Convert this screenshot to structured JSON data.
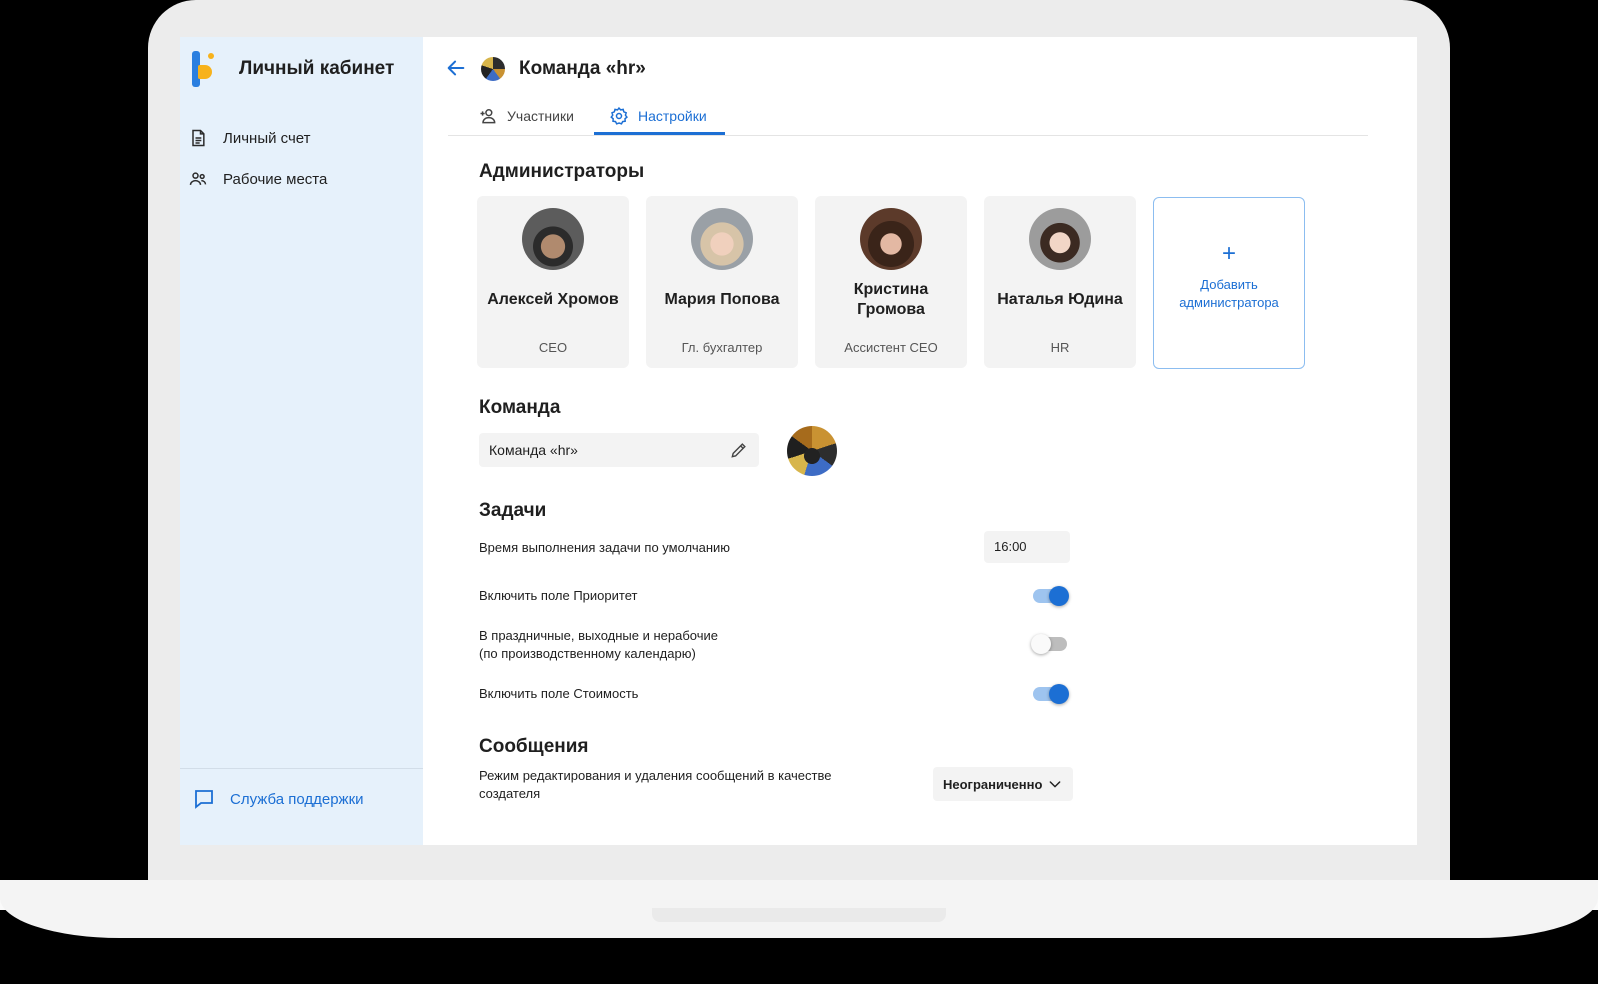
{
  "sidebar": {
    "app_title": "Личный кабинет",
    "items": [
      {
        "label": "Личный счет",
        "icon": "document-icon"
      },
      {
        "label": "Рабочие места",
        "icon": "people-icon"
      }
    ],
    "support_label": "Служба поддержки"
  },
  "header": {
    "title": "Команда «hr»"
  },
  "tabs": [
    {
      "label": "Участники",
      "icon": "add-person-icon",
      "active": false
    },
    {
      "label": "Настройки",
      "icon": "gear-icon",
      "active": true
    }
  ],
  "admins": {
    "section_title": "Администраторы",
    "cards": [
      {
        "name": "Алексей Хромов",
        "role": "CEO"
      },
      {
        "name": "Мария Попова",
        "role": "Гл. бухгалтер"
      },
      {
        "name": "Кристина Громова",
        "role": "Ассистент CEO"
      },
      {
        "name": "Наталья Юдина",
        "role": "HR"
      }
    ],
    "add_label": "Добавить администратора",
    "add_symbol": "+"
  },
  "team": {
    "section_title": "Команда",
    "name_value": "Команда «hr»"
  },
  "tasks": {
    "section_title": "Задачи",
    "default_time_label": "Время выполнения задачи по умолчанию",
    "default_time_value": "16:00",
    "priority_label": "Включить поле Приоритет",
    "priority_enabled": true,
    "holidays_label_line1": "В праздничные, выходные и нерабочие",
    "holidays_label_line2": "(по производственному календарю)",
    "holidays_enabled": false,
    "cost_label": "Включить поле Стоимость",
    "cost_enabled": true
  },
  "messages": {
    "section_title": "Сообщения",
    "edit_mode_label_line1": "Режим редактирования и удаления сообщений в качестве",
    "edit_mode_label_line2": "создателя",
    "edit_mode_value": "Неограниченно"
  },
  "colors": {
    "accent": "#1c6fd4",
    "sidebar_bg": "#e6f1fb",
    "logo_blue": "#2a7fe0",
    "logo_yellow": "#f7b21b"
  }
}
